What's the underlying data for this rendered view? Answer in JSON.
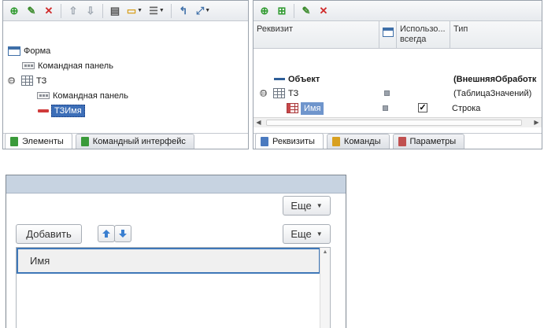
{
  "left_panel": {
    "toolbar": [
      "add",
      "edit",
      "delete",
      "move-up",
      "move-down",
      "properties",
      "form-view",
      "layout",
      "link",
      "zoom"
    ],
    "tree": [
      {
        "label": "Форма",
        "icon": "form-icon"
      },
      {
        "label": "Командная панель",
        "icon": "command-bar-icon"
      },
      {
        "label": "ТЗ",
        "icon": "table-icon",
        "expander": "⊟"
      },
      {
        "label": "Командная панель",
        "icon": "command-bar-icon"
      },
      {
        "label": "ТЗИмя",
        "icon": "field-icon",
        "selected": true
      }
    ],
    "tabs": [
      {
        "label": "Элементы",
        "color": "#3a9a3a",
        "active": true
      },
      {
        "label": "Командный интерфейс",
        "color": "#3a9a3a",
        "active": false
      }
    ]
  },
  "right_panel": {
    "columns": {
      "requisite": "Реквизит",
      "use_always": "Использо... всегда",
      "type": "Тип"
    },
    "rows": [
      {
        "name": "Объект",
        "type": "(ВнешняяОбработк",
        "bold": true
      },
      {
        "name": "ТЗ",
        "type": "(ТаблицаЗначений)",
        "expander": "⊟"
      },
      {
        "name": "Имя",
        "type": "Строка",
        "checked": true,
        "check_mark": "✓"
      }
    ],
    "tabs": [
      {
        "label": "Реквизиты",
        "color": "#4a7abf",
        "active": true
      },
      {
        "label": "Команды",
        "color": "#d8a020",
        "active": false
      },
      {
        "label": "Параметры",
        "color": "#c05050",
        "active": false
      }
    ]
  },
  "form": {
    "more_label_top": "Еще",
    "more_label": "Еще",
    "add_label": "Добавить",
    "column_header": "Имя"
  },
  "colors": {
    "accent": "#3d6fb8",
    "form_header": "#c7d3e1"
  }
}
